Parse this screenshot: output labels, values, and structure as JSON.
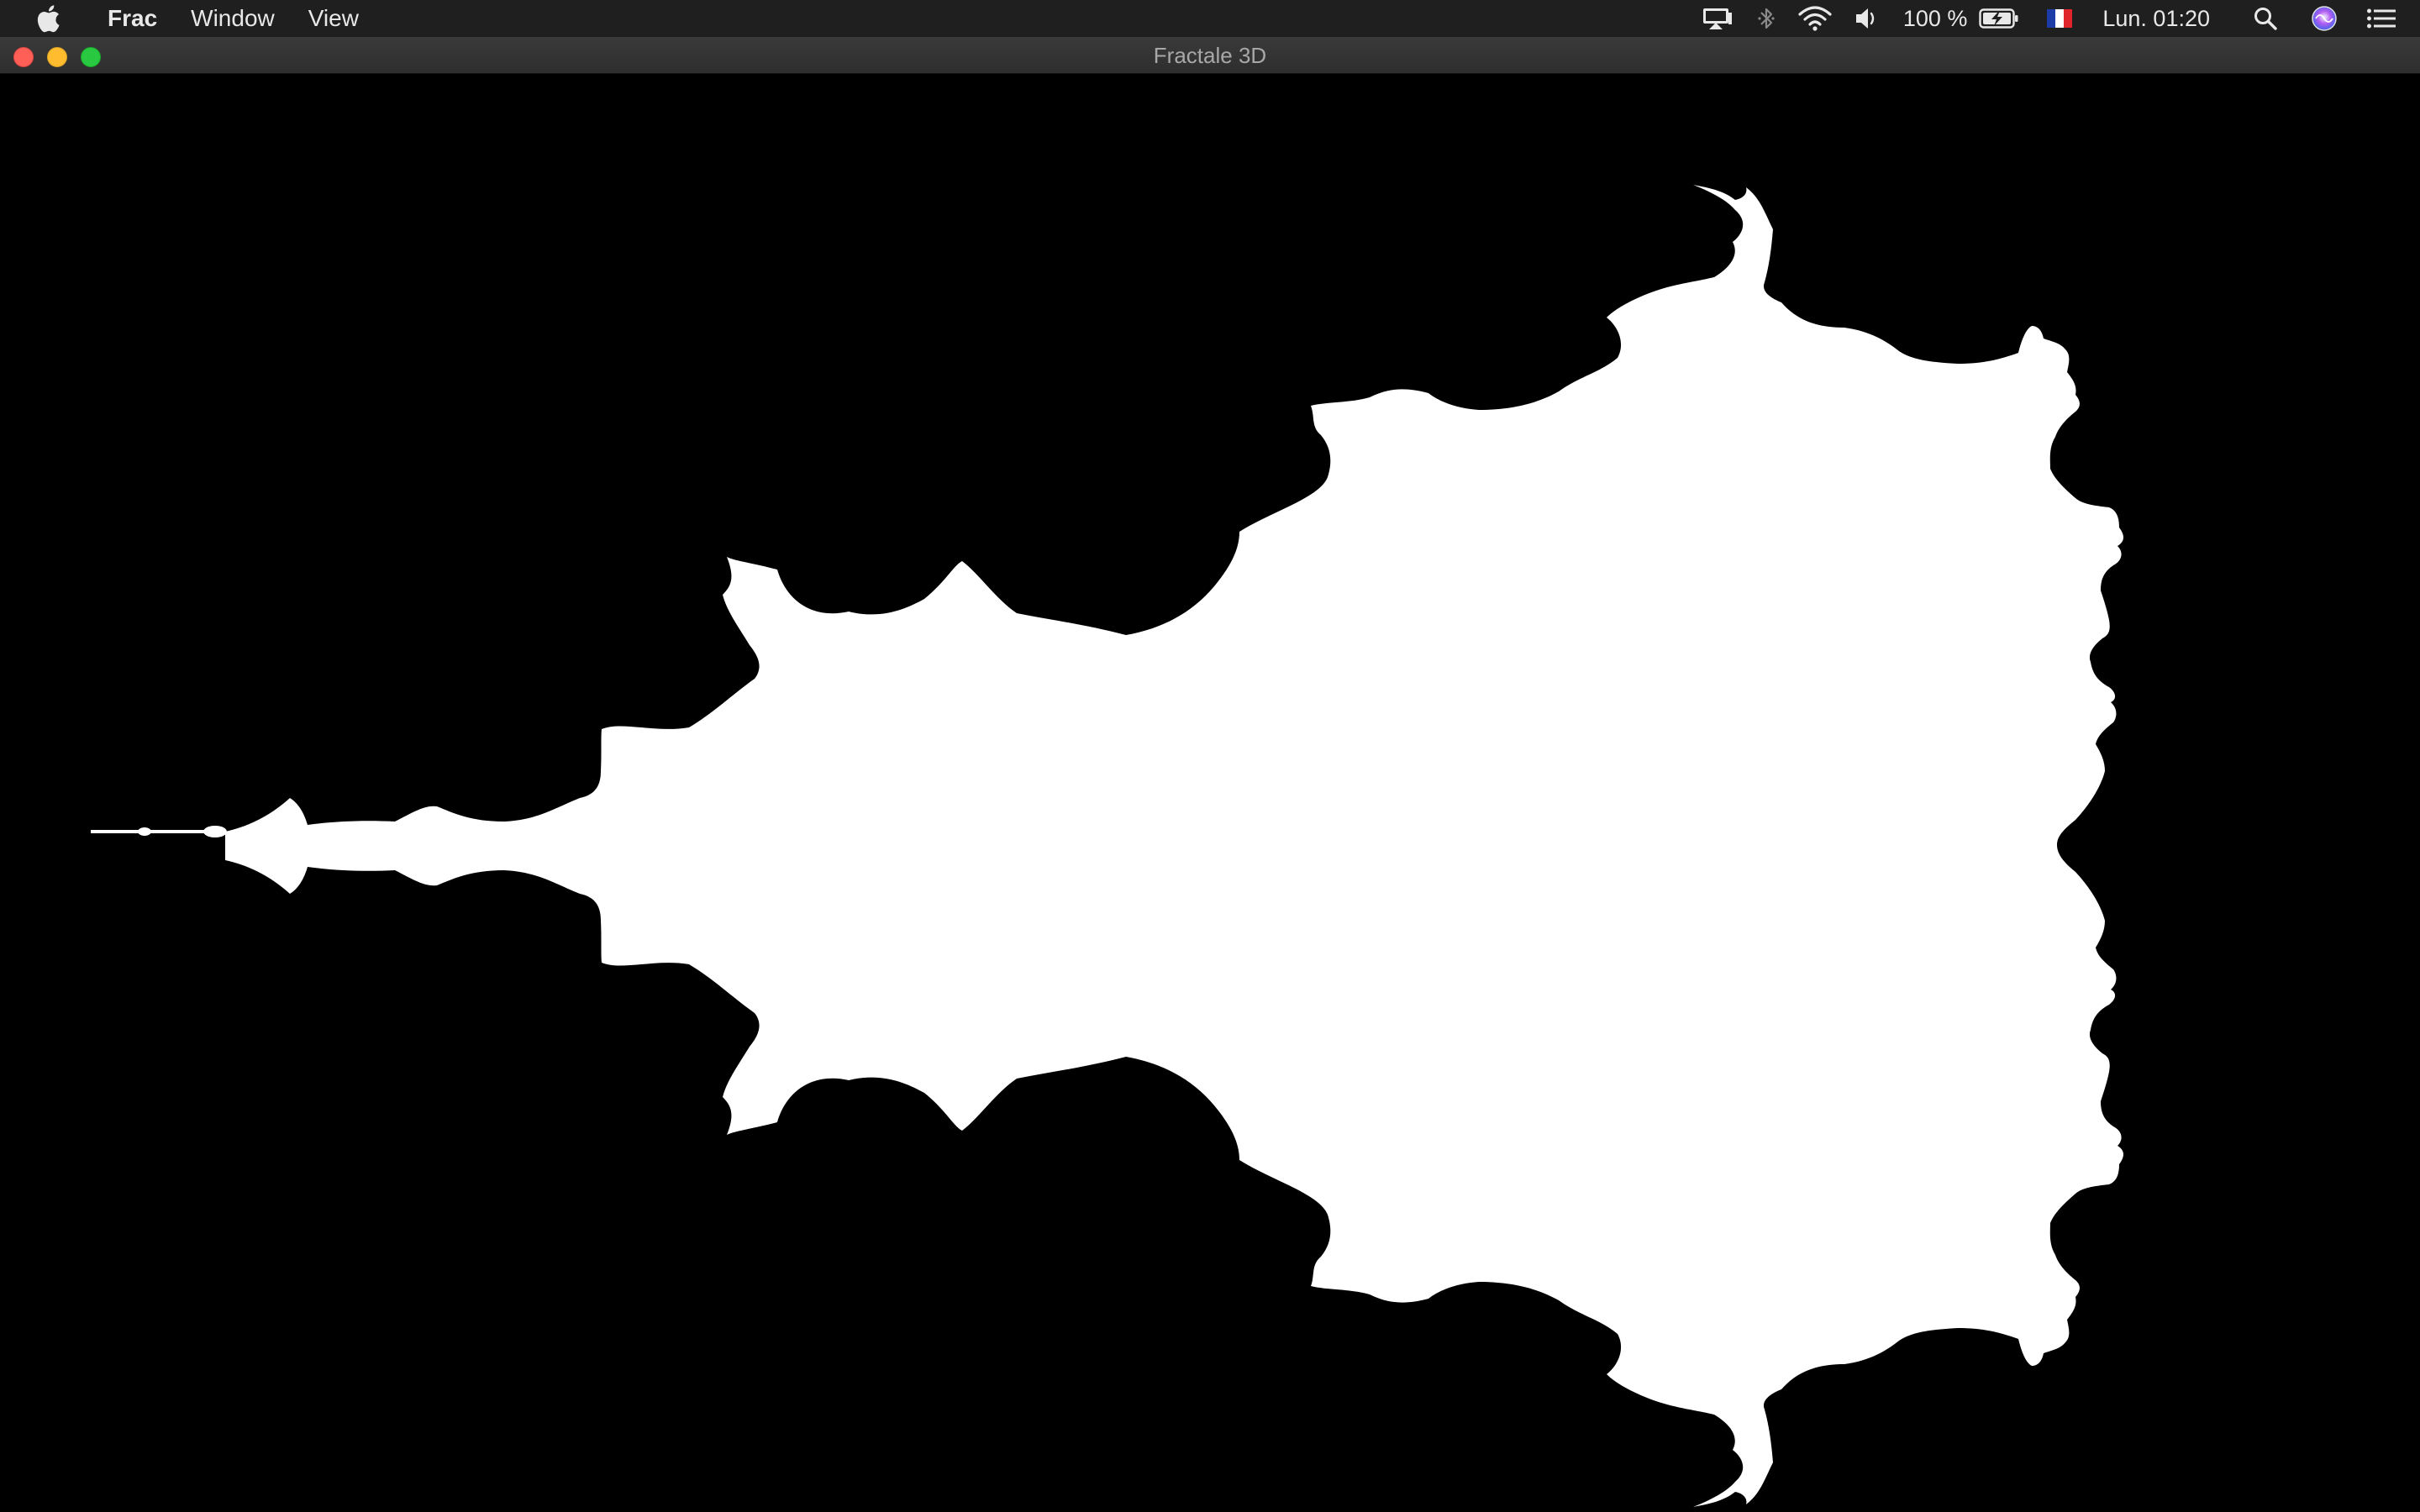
{
  "menubar": {
    "app_name": "Frac",
    "menus": [
      "Window",
      "View"
    ],
    "status": {
      "battery_percent": "100 %",
      "clock": "Lun. 01:20",
      "input_source": "French flag"
    }
  },
  "window": {
    "title": "Fractale 3D"
  },
  "fractal": {
    "name": "Mandelbrot set",
    "foreground_color": "#ffffff",
    "background_color": "#000000"
  },
  "colors": {
    "menubar_bg": "#1f1f1f",
    "titlebar_bg": "#333333",
    "close": "#ff5f57",
    "minimize": "#febc2e",
    "maximize": "#28c840"
  }
}
